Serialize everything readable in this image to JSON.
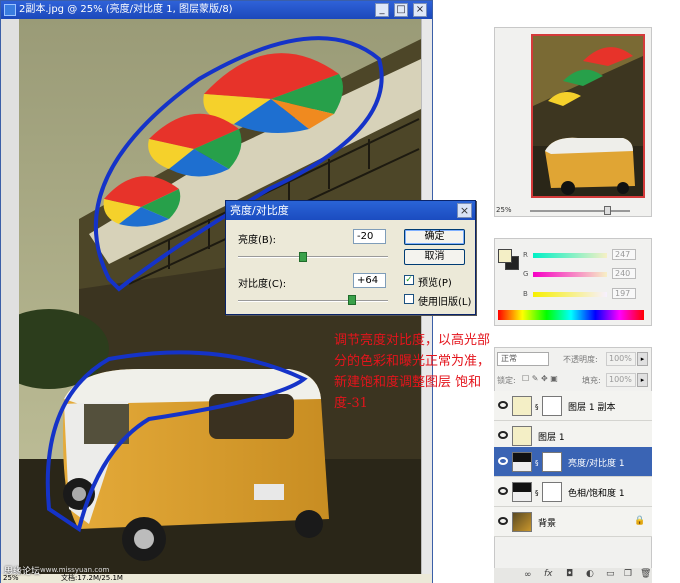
{
  "document": {
    "title": "2副本.jpg @ 25% (亮度/对比度 1, 图层蒙版/8)",
    "status_zoom": "25%",
    "status_doc": "文档:17.2M/25.1M",
    "watermark_site": "思缘论坛",
    "watermark_url": "www.missyuan.com"
  },
  "dialog": {
    "title": "亮度/对比度",
    "brightness_label": "亮度(B):",
    "brightness_value": "-20",
    "brightness_level": -20,
    "contrast_label": "对比度(C):",
    "contrast_value": "+64",
    "contrast_level": 64,
    "ok_label": "确定",
    "cancel_label": "取消",
    "preview_label": "预览(P)",
    "preview_checked": true,
    "legacy_label": "使用旧版(L)",
    "legacy_checked": false
  },
  "navigator": {
    "zoom": "25%"
  },
  "color_panel": {
    "r_label": "R",
    "r_value": "247",
    "g_label": "G",
    "g_value": "240",
    "b_label": "B",
    "b_value": "197",
    "foreground": "#f7f0c5",
    "background": "#222222"
  },
  "layers_panel": {
    "blend_mode": "正常",
    "opacity_label": "不透明度:",
    "opacity_value": "100%",
    "lock_label": "锁定:",
    "fill_label": "填充:",
    "fill_value": "100%",
    "layers": [
      {
        "name": "图层 1 副本",
        "selected": false,
        "thumb": "#f4efc6",
        "mask": true
      },
      {
        "name": "图层 1",
        "selected": false,
        "thumb": "#f4efc6",
        "mask": false
      },
      {
        "name": "亮度/对比度 1",
        "selected": true,
        "thumb": "adjust",
        "mask": true
      },
      {
        "name": "色相/饱和度 1",
        "selected": false,
        "thumb": "adjust",
        "mask": true
      },
      {
        "name": "背景",
        "selected": false,
        "thumb": "photo",
        "mask": false
      }
    ],
    "toolbar_icons": [
      "link-icon",
      "fx-icon",
      "mask-icon",
      "adjustment-icon",
      "folder-icon",
      "new-layer-icon",
      "trash-icon"
    ]
  },
  "annotation": {
    "text": "调节亮度对比度，以高光部分的色彩和曝光正常为准，新建饱和度调整图层 饱和度-31",
    "color": "#e4141c"
  }
}
